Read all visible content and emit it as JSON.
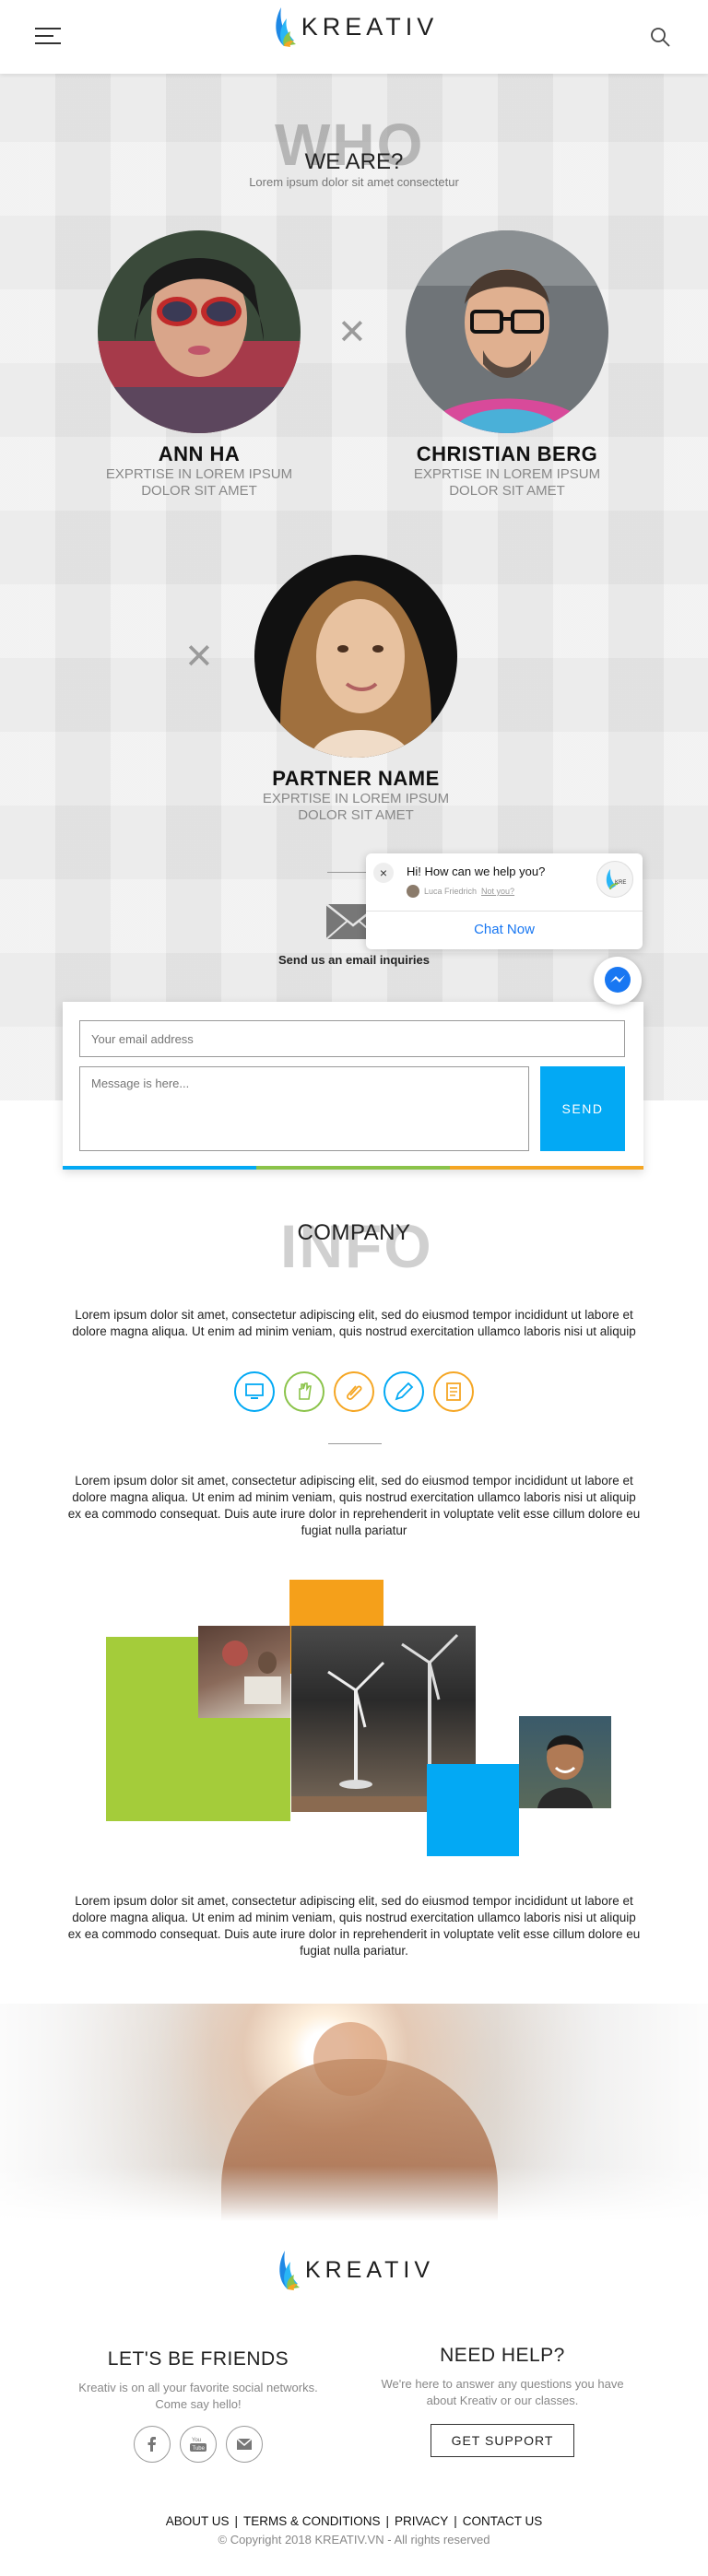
{
  "header": {
    "brand": "KREATIV"
  },
  "who": {
    "watermark": "WHO",
    "title": "WE ARE?",
    "lead": "Lorem ipsum dolor sit amet consectetur",
    "members": [
      {
        "name": "ANN HA",
        "role": "EXPRTISE IN LOREM IPSUM DOLOR SIT AMET"
      },
      {
        "name": "CHRISTIAN BERG",
        "role": "EXPRTISE IN LOREM IPSUM DOLOR SIT AMET"
      },
      {
        "name": "PARTNER NAME",
        "role": "EXPRTISE IN LOREM IPSUM DOLOR SIT AMET"
      }
    ],
    "mail_caption": "Send us an email inquiries"
  },
  "contact_form": {
    "email_placeholder": "Your email address",
    "message_placeholder": "Message is here...",
    "send_label": "SEND",
    "bar_colors": [
      "#03a9f4",
      "#8bc34a",
      "#f5a623"
    ]
  },
  "chat": {
    "question": "Hi! How can we help you?",
    "agent": "Luca Friedrich",
    "not_you": "Not you?",
    "chat_now": "Chat Now",
    "close_label": "×"
  },
  "info": {
    "watermark": "INFO",
    "title": "COMPANY",
    "para1": "Lorem ipsum dolor sit amet, consectetur adipiscing elit, sed do eiusmod tempor incididunt ut labore et dolore magna aliqua. Ut enim ad minim veniam, quis nostrud exercitation ullamco laboris nisi ut aliquip",
    "para2": "Lorem ipsum dolor sit amet, consectetur adipiscing elit, sed do eiusmod tempor incididunt ut labore et dolore magna aliqua. Ut enim ad minim veniam, quis nostrud exercitation ullamco laboris nisi ut aliquip ex ea commodo consequat. Duis aute irure dolor in reprehenderit in voluptate velit esse cillum dolore eu fugiat nulla pariatur",
    "para3": "Lorem ipsum dolor sit amet, consectetur adipiscing elit, sed do eiusmod tempor incididunt ut labore et dolore magna aliqua. Ut enim ad minim veniam, quis nostrud exercitation ullamco laboris nisi ut aliquip ex ea commodo consequat. Duis aute irure dolor in reprehenderit in voluptate velit esse cillum dolore eu fugiat nulla pariatur.",
    "icons": [
      {
        "name": "computer-icon",
        "color": "#03a9f4"
      },
      {
        "name": "hand-icon",
        "color": "#8bc34a"
      },
      {
        "name": "paperclip-icon",
        "color": "#f5a623"
      },
      {
        "name": "pen-icon",
        "color": "#03a9f4"
      },
      {
        "name": "notepad-icon",
        "color": "#f5a623"
      }
    ],
    "collage_colors": {
      "green": "#a4cc3a",
      "orange": "#f5a01a",
      "blue": "#03a9f4"
    }
  },
  "footer": {
    "brand": "KREATIV",
    "friends_title": "LET'S BE FRIENDS",
    "friends_text": "Kreativ is on all your favorite social networks. Come say hello!",
    "help_title": "NEED HELP?",
    "help_text": "We're here to answer any questions you have about Kreativ or our classes.",
    "support_label": "GET SUPPORT",
    "links": [
      "ABOUT US",
      "TERMS & CONDITIONS",
      "PRIVACY",
      "CONTACT US"
    ],
    "copyright": "© Copyright 2018 KREATIV.VN - All rights reserved"
  }
}
